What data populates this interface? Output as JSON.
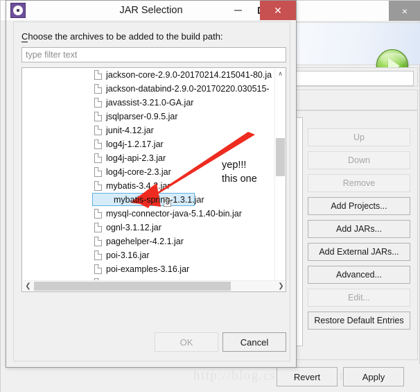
{
  "background_window": {
    "close_label": "×",
    "icons": {
      "play": "play-button-icon"
    },
    "side_buttons": [
      {
        "label": "Up",
        "enabled": false
      },
      {
        "label": "Down",
        "enabled": false
      },
      {
        "label": "Remove",
        "enabled": false
      },
      {
        "label": "Add Projects...",
        "enabled": true
      },
      {
        "label": "Add JARs...",
        "enabled": true
      },
      {
        "label": "Add External JARs...",
        "enabled": true
      },
      {
        "label": "Advanced...",
        "enabled": true
      },
      {
        "label": "Edit...",
        "enabled": false
      },
      {
        "label": "Restore Default Entries",
        "enabled": true
      }
    ],
    "bottom_buttons": {
      "revert": "Revert",
      "apply": "Apply"
    },
    "watermark": "http://blog.csdn.net/MorlyChin"
  },
  "dialog": {
    "title": "JAR Selection",
    "icon": "eclipse-gear-icon",
    "window_controls": {
      "minimize": "–",
      "maximize": "□",
      "close": "✕"
    },
    "instruction": "Choose the archives to be added to the build path:",
    "instruction_mnemonic": "C",
    "instruction_rest": "hoose the archives to be added to the build path:",
    "filter": {
      "placeholder": "type filter text",
      "value": ""
    },
    "list": {
      "items": [
        {
          "label": "jackson-core-2.9.0-20170214.215041-80.ja",
          "selected": false
        },
        {
          "label": "jackson-databind-2.9.0-20170220.030515-",
          "selected": false
        },
        {
          "label": "javassist-3.21.0-GA.jar",
          "selected": false
        },
        {
          "label": "jsqlparser-0.9.5.jar",
          "selected": false
        },
        {
          "label": "junit-4.12.jar",
          "selected": false
        },
        {
          "label": "log4j-1.2.17.jar",
          "selected": false
        },
        {
          "label": "log4j-api-2.3.jar",
          "selected": false
        },
        {
          "label": "log4j-core-2.3.jar",
          "selected": false
        },
        {
          "label": "mybatis-3.4.2.jar",
          "selected": false
        },
        {
          "label": "mybatis-spring-1.3.1.jar",
          "selected": true
        },
        {
          "label": "mysql-connector-java-5.1.40-bin.jar",
          "selected": false
        },
        {
          "label": "ognl-3.1.12.jar",
          "selected": false
        },
        {
          "label": "pagehelper-4.2.1.jar",
          "selected": false
        },
        {
          "label": "poi-3.16.jar",
          "selected": false
        },
        {
          "label": "poi-examples-3.16.jar",
          "selected": false
        }
      ],
      "scroll": {
        "vertical_arrow_up": "∧",
        "vertical_arrow_down": "∨",
        "horizontal_arrow_left": "❮",
        "horizontal_arrow_right": "❯"
      }
    },
    "buttons": [
      {
        "label": "OK",
        "enabled": false
      },
      {
        "label": "Cancel",
        "enabled": true
      }
    ]
  },
  "annotations": {
    "line1": "yep!!!",
    "line2": "this one",
    "arrow_color": "#ee2b20"
  },
  "colors": {
    "close_red": "#c75050",
    "selection_fill": "#d6ecfb",
    "selection_border": "#5fb0e0",
    "annotation_red": "#ee2b20",
    "play_green": "#6fbf2a"
  }
}
